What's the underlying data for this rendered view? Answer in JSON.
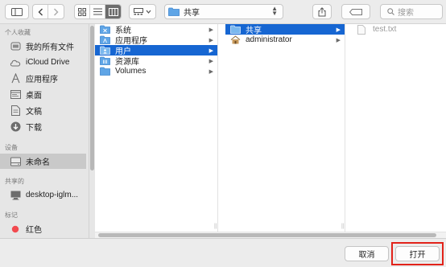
{
  "toolbar": {
    "location": "共享",
    "search_placeholder": "搜索"
  },
  "sidebar": {
    "sections": [
      {
        "heading": "个人收藏",
        "items": [
          "我的所有文件",
          "iCloud Drive",
          "应用程序",
          "桌面",
          "文稿",
          "下载"
        ]
      },
      {
        "heading": "设备",
        "items": [
          "未命名"
        ]
      },
      {
        "heading": "共享的",
        "items": [
          "desktop-iglm..."
        ]
      },
      {
        "heading": "标记",
        "items": [
          "红色"
        ]
      }
    ],
    "tag_color": "#f24a4f"
  },
  "columns": {
    "col1": [
      "系统",
      "应用程序",
      "用户",
      "资源库",
      "Volumes"
    ],
    "col2": [
      "共享",
      "administrator"
    ],
    "col3": [
      "test.txt"
    ]
  },
  "buttons": {
    "cancel": "取消",
    "open": "打开"
  },
  "colors": {
    "selection": "#1666d2",
    "folder": "#5fa5e6",
    "highlight_border": "#e2231a"
  }
}
